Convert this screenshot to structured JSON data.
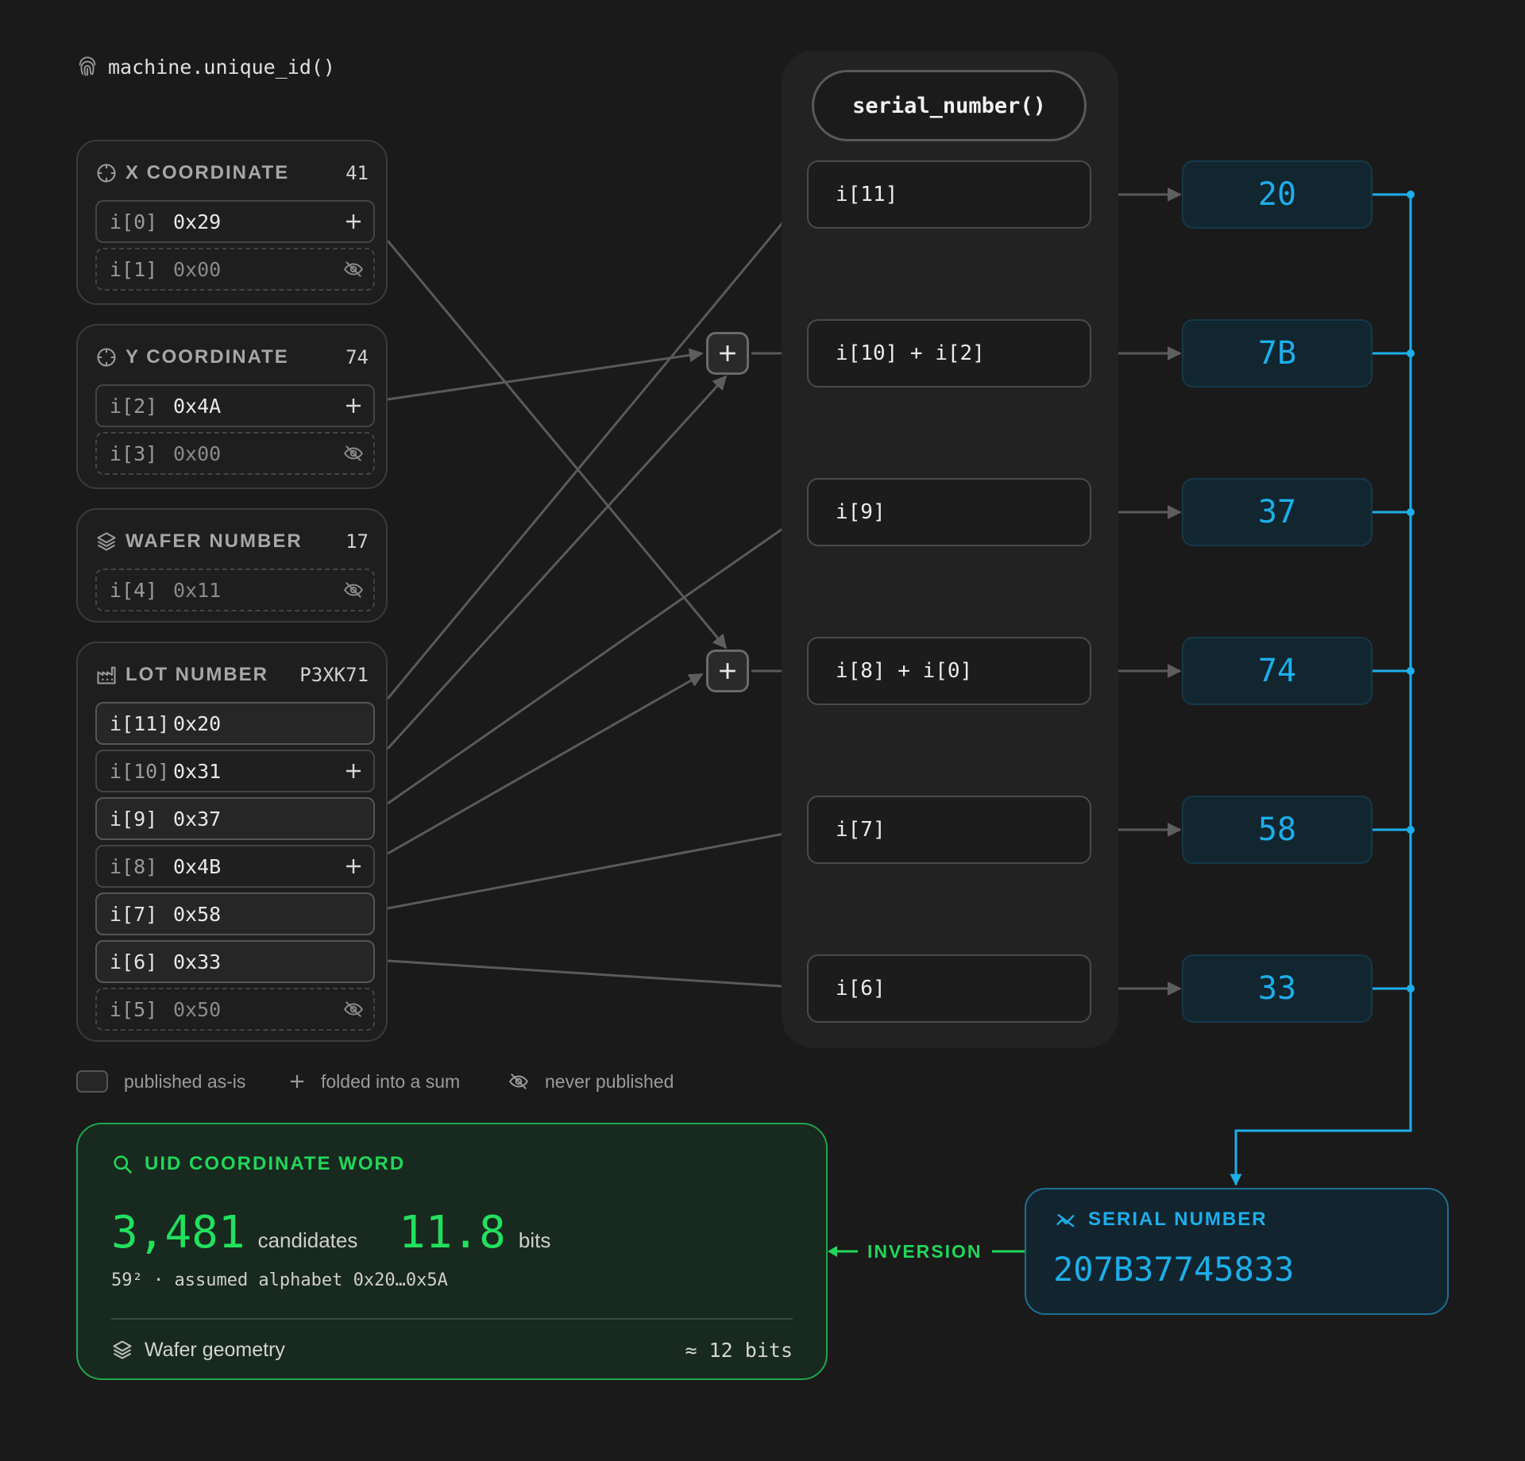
{
  "header": {
    "title": "machine.unique_id()"
  },
  "groups": [
    {
      "title": "X COORDINATE",
      "value": "41",
      "icon": "crosshair-icon",
      "cells": [
        {
          "idx": "i[0]",
          "val": "0x29",
          "kind": "sum"
        },
        {
          "idx": "i[1]",
          "val": "0x00",
          "kind": "hidden"
        }
      ]
    },
    {
      "title": "Y COORDINATE",
      "value": "74",
      "icon": "crosshair-icon",
      "cells": [
        {
          "idx": "i[2]",
          "val": "0x4A",
          "kind": "sum"
        },
        {
          "idx": "i[3]",
          "val": "0x00",
          "kind": "hidden"
        }
      ]
    },
    {
      "title": "WAFER NUMBER",
      "value": "17",
      "icon": "layers-icon",
      "cells": [
        {
          "idx": "i[4]",
          "val": "0x11",
          "kind": "hidden"
        }
      ]
    },
    {
      "title": "LOT NUMBER",
      "value": "P3XK71",
      "icon": "factory-icon",
      "cells": [
        {
          "idx": "i[11]",
          "val": "0x20",
          "kind": "solid"
        },
        {
          "idx": "i[10]",
          "val": "0x31",
          "kind": "sum"
        },
        {
          "idx": "i[9]",
          "val": "0x37",
          "kind": "solid"
        },
        {
          "idx": "i[8]",
          "val": "0x4B",
          "kind": "sum"
        },
        {
          "idx": "i[7]",
          "val": "0x58",
          "kind": "solid"
        },
        {
          "idx": "i[6]",
          "val": "0x33",
          "kind": "solid"
        },
        {
          "idx": "i[5]",
          "val": "0x50",
          "kind": "hidden"
        }
      ]
    }
  ],
  "legend": {
    "published": "published as-is",
    "folded": "folded into a sum",
    "never": "never published"
  },
  "function": {
    "label": "serial_number()"
  },
  "slots": [
    "i[11]",
    "i[10] + i[2]",
    "i[9]",
    "i[8] + i[0]",
    "i[7]",
    "i[6]"
  ],
  "bytes": [
    "20",
    "7B",
    "37",
    "74",
    "58",
    "33"
  ],
  "uid": {
    "title": "UID COORDINATE WORD",
    "candidates": "3,481",
    "candidates_unit": "candidates",
    "bits": "11.8",
    "bits_unit": "bits",
    "subtitle": "59² · assumed alphabet 0x20…0x5A",
    "footer_label": "Wafer geometry",
    "footer_value": "≈ 12 bits"
  },
  "inversion": {
    "label": "INVERSION"
  },
  "serial": {
    "title": "SERIAL NUMBER",
    "value": "207B37745833"
  },
  "colors": {
    "background": "#1a1a1a",
    "accent_blue": "#1eaeea",
    "accent_green": "#22d65a",
    "connector_gray": "#5a5a5a"
  }
}
